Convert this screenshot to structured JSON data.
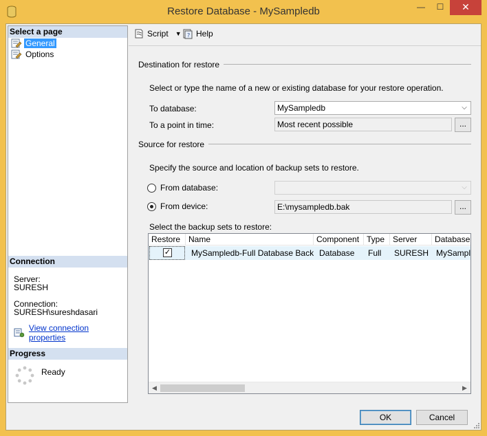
{
  "window": {
    "title": "Restore Database - MySampledb",
    "min_glyph": "—",
    "max_glyph": "☐",
    "close_glyph": "✕"
  },
  "left": {
    "select_page_heading": "Select a page",
    "pages": [
      {
        "label": "General",
        "icon": "page-wrench-icon",
        "selected": true
      },
      {
        "label": "Options",
        "icon": "page-wrench-icon",
        "selected": false
      }
    ],
    "connection_heading": "Connection",
    "server_label": "Server:",
    "server_value": "SURESH",
    "connection_label": "Connection:",
    "connection_value": "SURESH\\sureshdasari",
    "view_connection_link": "View connection properties",
    "progress_heading": "Progress",
    "progress_status": "Ready"
  },
  "toolbar": {
    "script_label": "Script",
    "help_label": "Help"
  },
  "destination": {
    "group_title": "Destination for restore",
    "description": "Select or type the name of a new or existing database for your restore operation.",
    "to_database_label": "To database:",
    "to_database_value": "MySampledb",
    "point_in_time_label": "To a point in time:",
    "point_in_time_value": "Most recent possible",
    "ellipsis": "..."
  },
  "source": {
    "group_title": "Source for restore",
    "description": "Specify the source and location of backup sets to restore.",
    "from_database_label": "From database:",
    "from_database_value": "",
    "from_database_selected": false,
    "from_device_label": "From device:",
    "from_device_value": "E:\\mysampledb.bak",
    "from_device_selected": true,
    "ellipsis": "..."
  },
  "backup_sets": {
    "label": "Select the backup sets to restore:",
    "columns": [
      "Restore",
      "Name",
      "Component",
      "Type",
      "Server",
      "Database"
    ],
    "rows": [
      {
        "restore": true,
        "name": "MySampledb-Full Database Backup",
        "component": "Database",
        "type": "Full",
        "server": "SURESH",
        "database": "MySampledb"
      }
    ],
    "scroll_left": "◀",
    "scroll_right": "▶"
  },
  "footer": {
    "ok_label": "OK",
    "cancel_label": "Cancel"
  },
  "colors": {
    "title_bar": "#f2c14e",
    "close_button": "#c7423a",
    "section_header": "#d4e0f0",
    "selection": "#3399ff",
    "link": "#0033cc"
  }
}
